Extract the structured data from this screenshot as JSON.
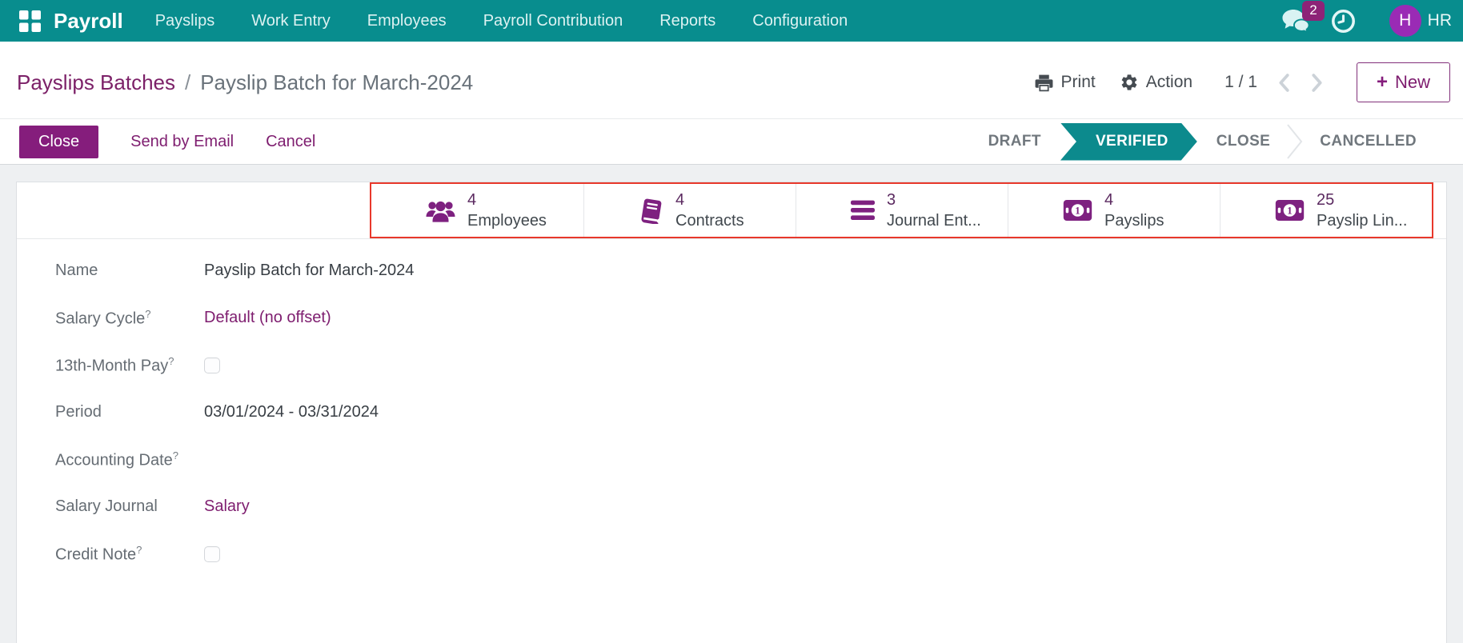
{
  "navbar": {
    "app": "Payroll",
    "menus": [
      "Payslips",
      "Work Entry",
      "Employees",
      "Payroll Contribution",
      "Reports",
      "Configuration"
    ],
    "badge": "2",
    "avatar_initial": "H",
    "user": "HR"
  },
  "breadcrumb": {
    "parent": "Payslips Batches",
    "separator": "/",
    "current": "Payslip Batch for March-2024"
  },
  "toolbar": {
    "print_label": "Print",
    "action_label": "Action",
    "pager": "1 / 1",
    "new_label": "New",
    "new_plus": "+"
  },
  "actions": {
    "close": "Close",
    "send_email": "Send by Email",
    "cancel": "Cancel"
  },
  "statusbar": {
    "states": [
      {
        "label": "DRAFT",
        "active": false
      },
      {
        "label": "VERIFIED",
        "active": true
      },
      {
        "label": "CLOSE",
        "active": false
      },
      {
        "label": "CANCELLED",
        "active": false
      }
    ]
  },
  "smart_buttons": [
    {
      "count": "4",
      "label": "Employees",
      "icon": "users-icon"
    },
    {
      "count": "4",
      "label": "Contracts",
      "icon": "book-icon"
    },
    {
      "count": "3",
      "label": "Journal Ent...",
      "icon": "bars-icon"
    },
    {
      "count": "4",
      "label": "Payslips",
      "icon": "money-icon"
    },
    {
      "count": "25",
      "label": "Payslip Lin...",
      "icon": "money-icon"
    }
  ],
  "form": {
    "fields": [
      {
        "label": "Name",
        "help": false,
        "type": "text",
        "value": "Payslip Batch for March-2024"
      },
      {
        "label": "Salary Cycle",
        "help": true,
        "type": "link",
        "value": "Default (no offset)"
      },
      {
        "label": "13th-Month Pay",
        "help": true,
        "type": "checkbox",
        "checked": false
      },
      {
        "label": "Period",
        "help": false,
        "type": "text",
        "value": "03/01/2024 - 03/31/2024"
      },
      {
        "label": "Accounting Date",
        "help": true,
        "type": "empty",
        "value": ""
      },
      {
        "label": "Salary Journal",
        "help": false,
        "type": "link",
        "value": "Salary"
      },
      {
        "label": "Credit Note",
        "help": true,
        "type": "checkbox",
        "checked": false
      }
    ]
  },
  "colors": {
    "navbar_teal": "#088d8e",
    "status_active_teal": "#0c8a8d",
    "primary_purple": "#851d7c",
    "link_purple": "#7e1d6f",
    "avatar_purple": "#9a2bb5",
    "badge_purple": "#8d2377",
    "highlight_red": "#e8382b"
  }
}
